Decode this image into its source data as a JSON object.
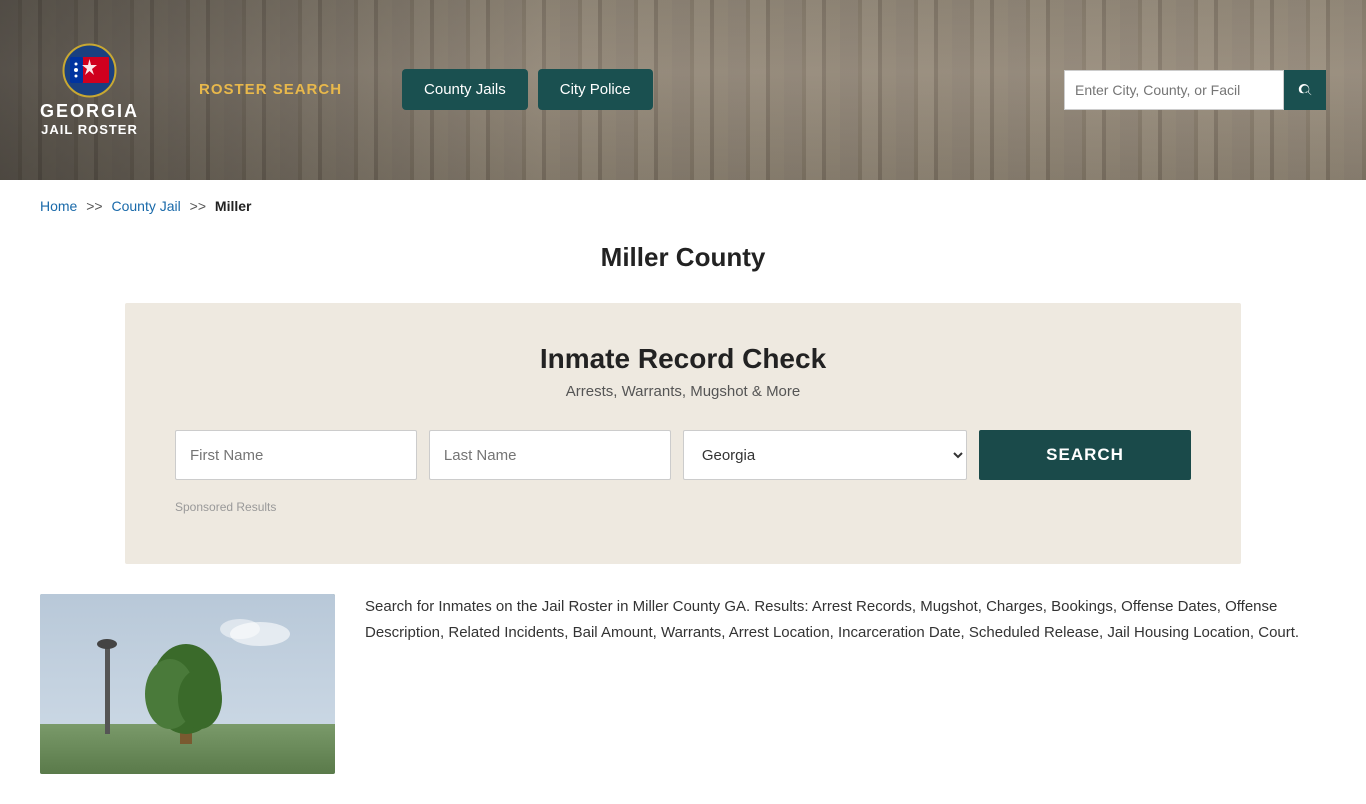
{
  "site": {
    "name": "GEORGIA JAIL ROSTER",
    "name_line1": "GEORGIA",
    "name_line2": "JAIL ROSTER"
  },
  "header": {
    "nav_link": "ROSTER SEARCH",
    "county_jails_btn": "County Jails",
    "city_police_btn": "City Police",
    "search_placeholder": "Enter City, County, or Facil"
  },
  "breadcrumb": {
    "home": "Home",
    "sep1": ">>",
    "county_jail": "County Jail",
    "sep2": ">>",
    "current": "Miller"
  },
  "page_title": "Miller County",
  "inmate_check": {
    "title": "Inmate Record Check",
    "subtitle": "Arrests, Warrants, Mugshot & More",
    "first_name_placeholder": "First Name",
    "last_name_placeholder": "Last Name",
    "state_default": "Georgia",
    "search_btn": "SEARCH",
    "sponsored_label": "Sponsored Results"
  },
  "description": {
    "text": "Search for Inmates on the Jail Roster in Miller County GA. Results: Arrest Records, Mugshot, Charges, Bookings, Offense Dates, Offense Description, Related Incidents, Bail Amount, Warrants, Arrest Location, Incarceration Date, Scheduled Release, Jail Housing Location, Court."
  }
}
